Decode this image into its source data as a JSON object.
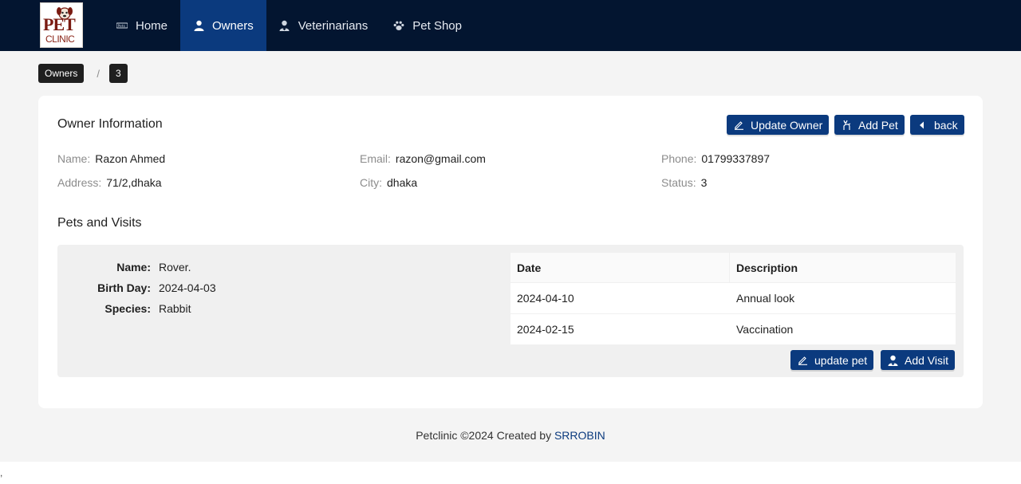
{
  "brand": {
    "logo_text_top": "PET",
    "logo_text_bottom": "CLINIC"
  },
  "nav": {
    "items": [
      {
        "label": "Home",
        "icon": "pets-icon"
      },
      {
        "label": "Owners",
        "icon": "user-icon",
        "active": true
      },
      {
        "label": "Veterinarians",
        "icon": "doctor-icon"
      },
      {
        "label": "Pet Shop",
        "icon": "paw-icon"
      }
    ]
  },
  "breadcrumb": {
    "items": [
      "Owners",
      "3"
    ],
    "separator": "/"
  },
  "owner": {
    "title": "Owner Information",
    "buttons": {
      "update": "Update Owner",
      "add_pet": "Add Pet",
      "back": "back"
    },
    "fields": {
      "name": {
        "label": "Name:",
        "value": "Razon Ahmed"
      },
      "email": {
        "label": "Email:",
        "value": "razon@gmail.com"
      },
      "phone": {
        "label": "Phone:",
        "value": "01799337897"
      },
      "address": {
        "label": "Address:",
        "value": "71/2,dhaka"
      },
      "city": {
        "label": "City:",
        "value": "dhaka"
      },
      "status": {
        "label": "Status:",
        "value": "3"
      }
    }
  },
  "pets": {
    "title": "Pets and Visits",
    "pet": {
      "name": {
        "label": "Name:",
        "value": "Rover."
      },
      "birth": {
        "label": "Birth Day:",
        "value": "2024-04-03"
      },
      "species": {
        "label": "Species:",
        "value": "Rabbit"
      }
    },
    "visits": {
      "headers": [
        "Date",
        "Description"
      ],
      "rows": [
        [
          "2024-04-10",
          "Annual look"
        ],
        [
          "2024-02-15",
          "Vaccination"
        ]
      ]
    },
    "buttons": {
      "update_pet": "update pet",
      "add_visit": "Add Visit"
    }
  },
  "footer": {
    "text": "Petclinic ©2024 Created by ",
    "link": "SRROBIN"
  },
  "stray_char": ",",
  "colors": {
    "nav_bg": "#031530",
    "accent": "#0b3a7e",
    "page_bg": "#f4f4f4"
  }
}
